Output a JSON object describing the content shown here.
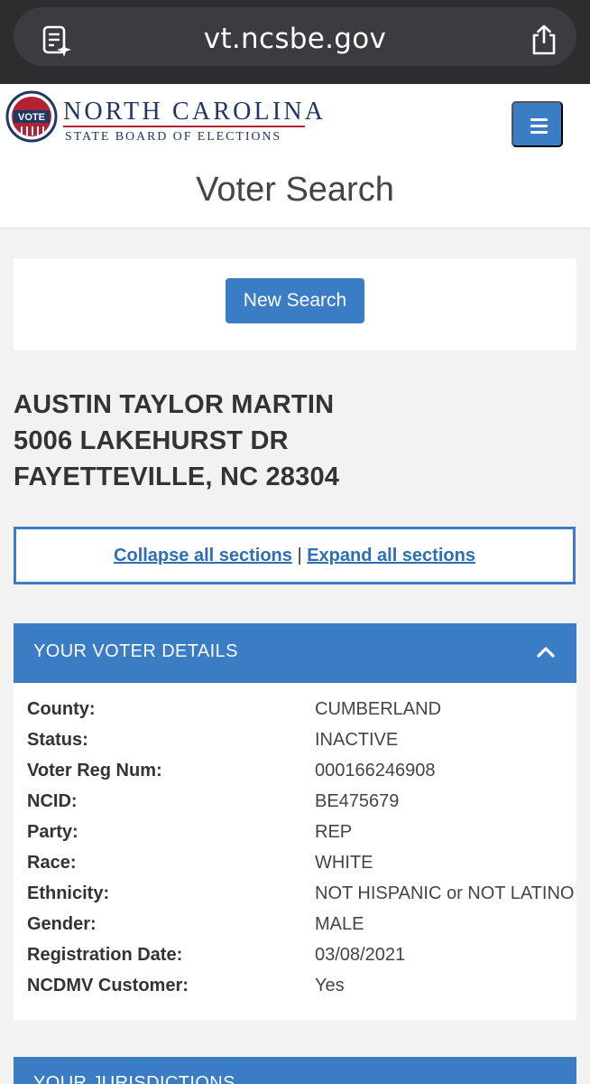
{
  "browser": {
    "url": "vt.ncsbe.gov",
    "icons": [
      "reader-icon",
      "share-icon"
    ]
  },
  "header": {
    "logo_badge": "VOTE",
    "logo_title": "NORTH CAROLINA",
    "logo_subtitle": "STATE BOARD OF ELECTIONS",
    "menu_icon": "hamburger-menu-icon",
    "page_title": "Voter Search"
  },
  "search": {
    "new_search_label": "New Search"
  },
  "voter": {
    "name": "AUSTIN TAYLOR MARTIN",
    "street": "5006 LAKEHURST DR",
    "city_state_zip": "FAYETTEVILLE, NC 28304"
  },
  "toggles": {
    "collapse_label": "Collapse all sections",
    "separator": "|",
    "expand_label": "Expand all sections"
  },
  "details": {
    "title": "YOUR VOTER DETAILS",
    "chevron_icon": "chevron-up-icon",
    "rows": [
      {
        "label": "County:",
        "value": "CUMBERLAND"
      },
      {
        "label": "Status:",
        "value": "INACTIVE"
      },
      {
        "label": "Voter Reg Num:",
        "value": "000166246908"
      },
      {
        "label": "NCID:",
        "value": "BE475679"
      },
      {
        "label": "Party:",
        "value": "REP"
      },
      {
        "label": "Race:",
        "value": "WHITE"
      },
      {
        "label": "Ethnicity:",
        "value": "NOT HISPANIC or NOT LATINO"
      },
      {
        "label": "Gender:",
        "value": "MALE"
      },
      {
        "label": "Registration Date:",
        "value": "03/08/2021"
      },
      {
        "label": "NCDMV Customer:",
        "value": "Yes"
      }
    ]
  },
  "jurisdictions": {
    "title": "YOUR JURISDICTIONS"
  },
  "colors": {
    "accent": "#3a7dc4",
    "link": "#2c6fb3",
    "logo_navy": "#1f3864",
    "logo_red": "#b22234",
    "page_bg": "#f2f2f2"
  }
}
